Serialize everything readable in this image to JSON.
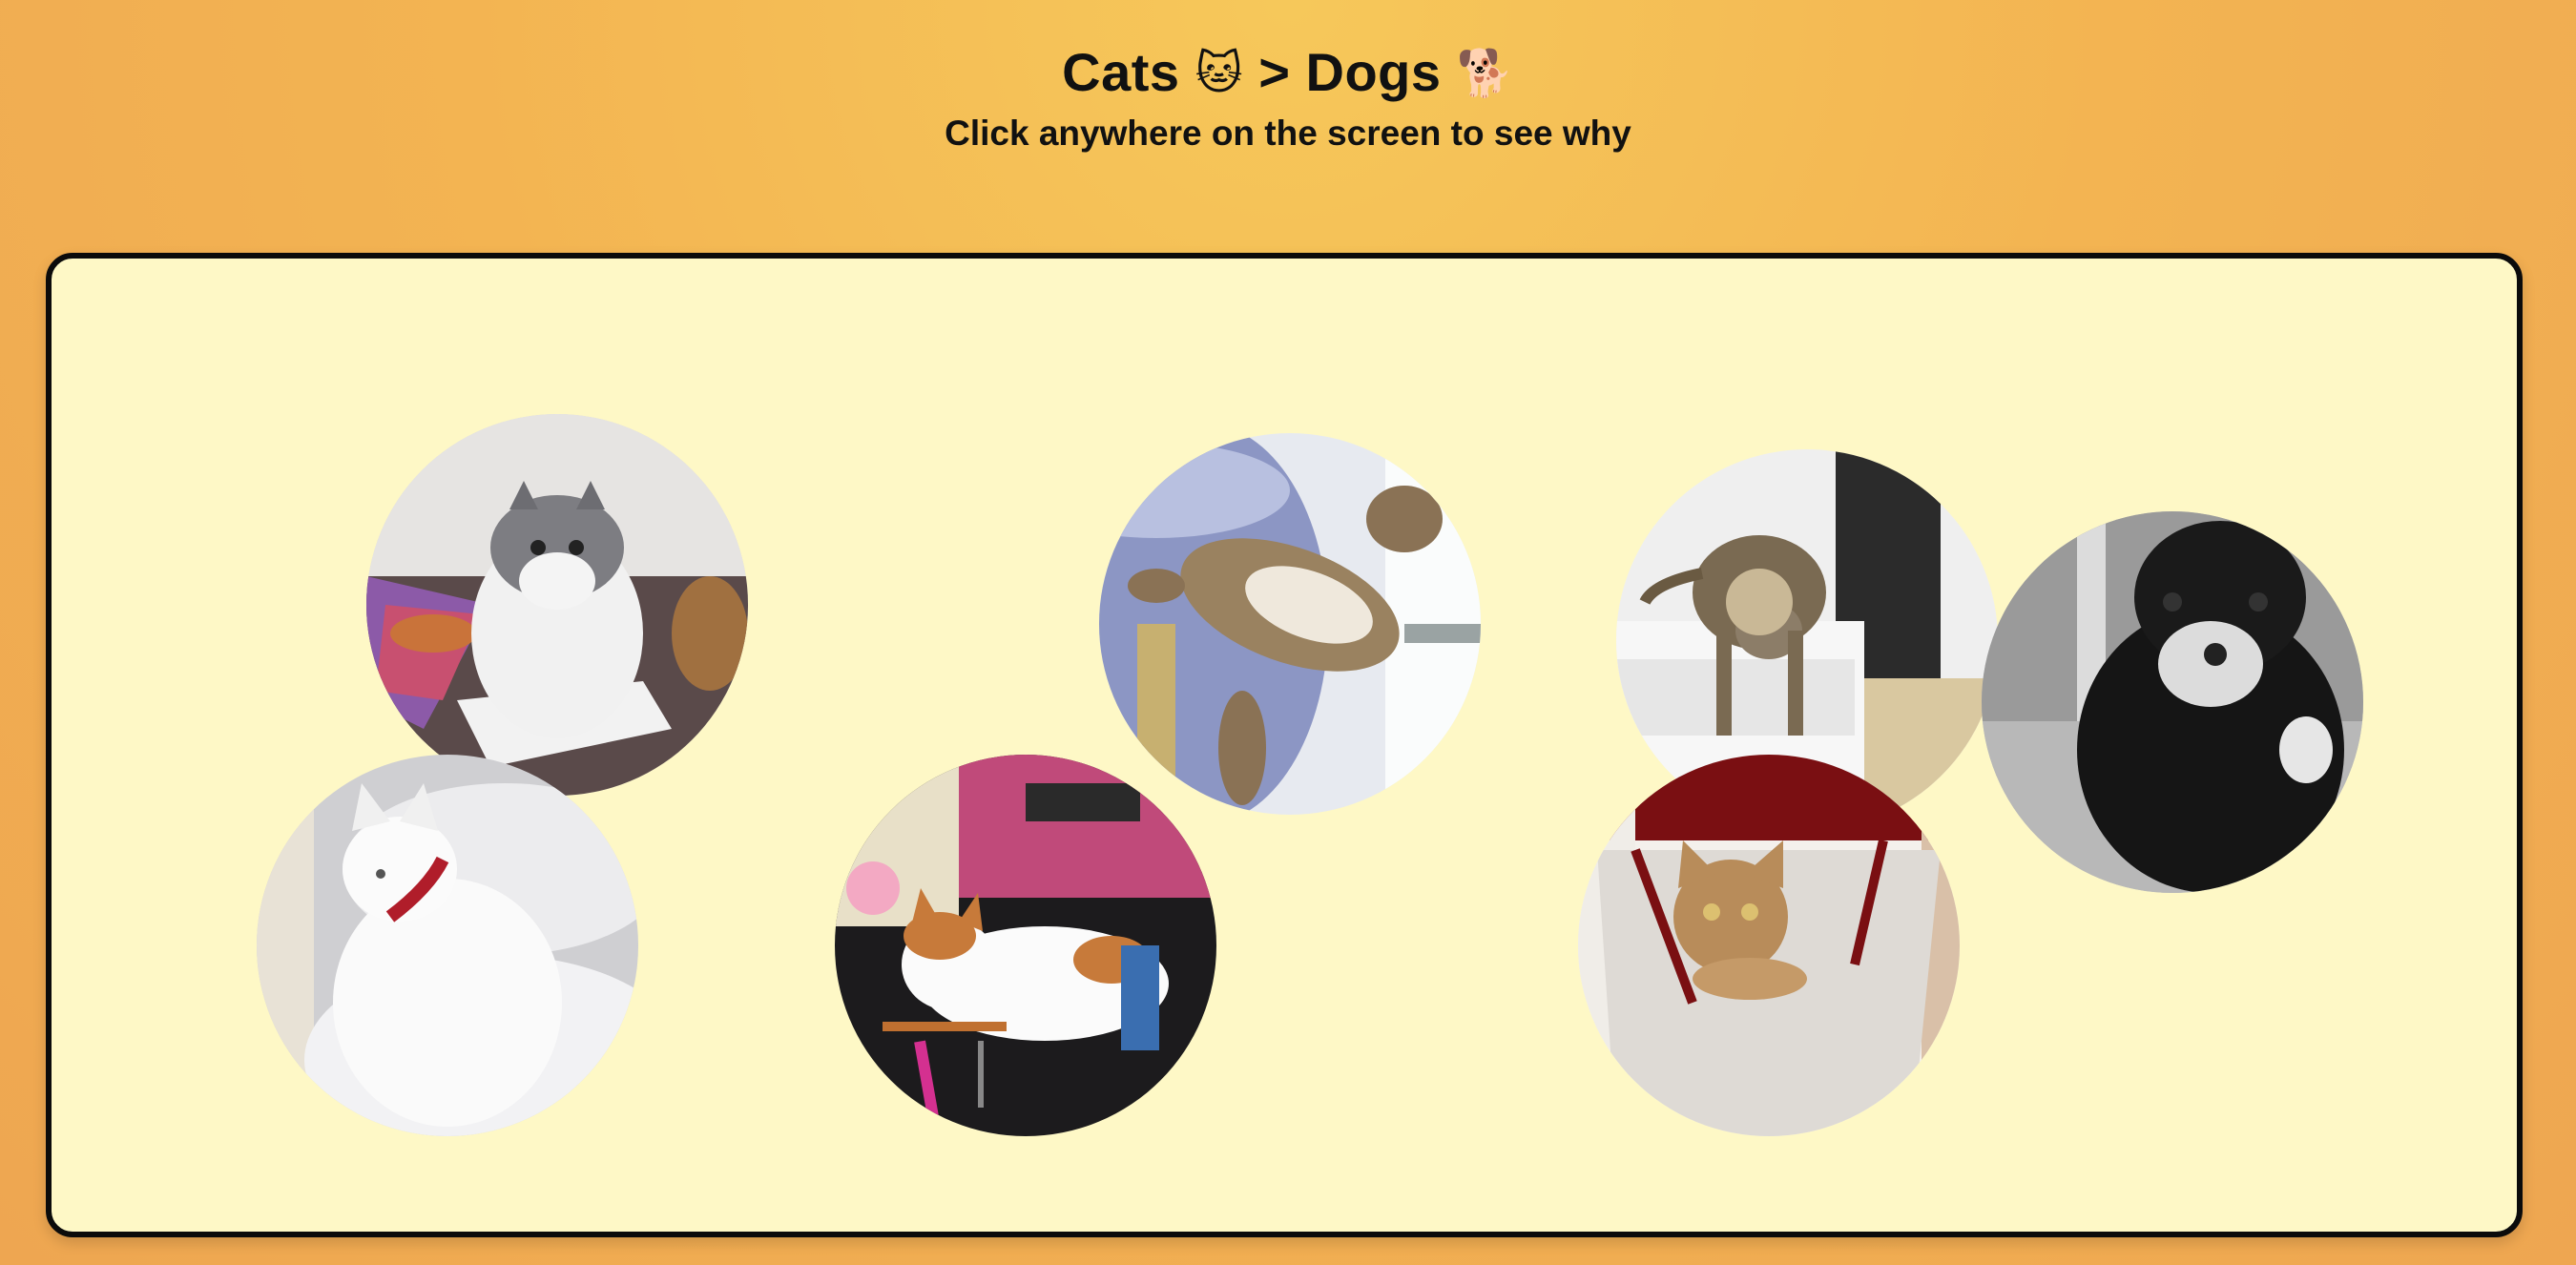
{
  "header": {
    "title_part1": "Cats",
    "cat_emoji": "🐱",
    "title_part2": "> Dogs",
    "dog_emoji": "🐕",
    "subtitle": "Click anywhere on the screen to see why"
  },
  "colors": {
    "background": "#f3b452",
    "board": "#fef8c6",
    "border": "#0b0b0b"
  },
  "cats": [
    {
      "name": "fluffy-grey-cat-in-box"
    },
    {
      "name": "white-cat-red-collar-on-bed"
    },
    {
      "name": "tabby-cat-held-upside-down"
    },
    {
      "name": "calico-cat-on-makeup-desk"
    },
    {
      "name": "tabby-cat-on-couch-arm"
    },
    {
      "name": "tabby-cat-in-hammock"
    },
    {
      "name": "black-white-kitten-blurry"
    }
  ]
}
